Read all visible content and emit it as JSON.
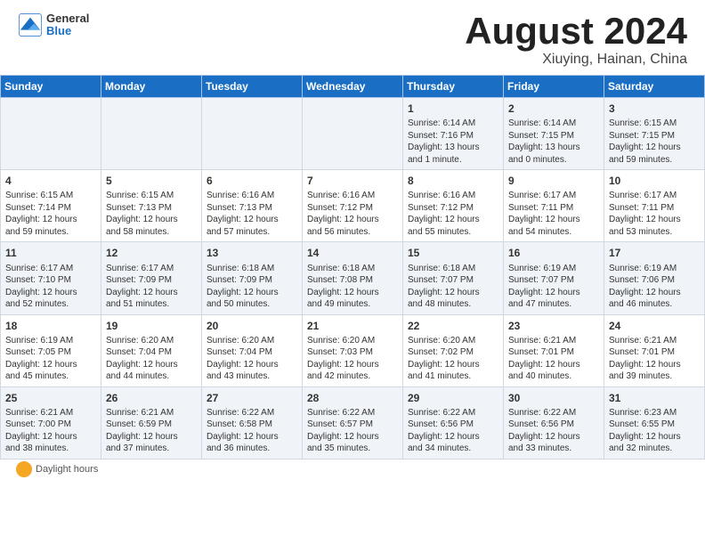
{
  "header": {
    "logo_general": "General",
    "logo_blue": "Blue",
    "title": "August 2024",
    "location": "Xiuying, Hainan, China"
  },
  "days_of_week": [
    "Sunday",
    "Monday",
    "Tuesday",
    "Wednesday",
    "Thursday",
    "Friday",
    "Saturday"
  ],
  "weeks": [
    [
      {
        "num": "",
        "info": ""
      },
      {
        "num": "",
        "info": ""
      },
      {
        "num": "",
        "info": ""
      },
      {
        "num": "",
        "info": ""
      },
      {
        "num": "1",
        "info": "Sunrise: 6:14 AM\nSunset: 7:16 PM\nDaylight: 13 hours\nand 1 minute."
      },
      {
        "num": "2",
        "info": "Sunrise: 6:14 AM\nSunset: 7:15 PM\nDaylight: 13 hours\nand 0 minutes."
      },
      {
        "num": "3",
        "info": "Sunrise: 6:15 AM\nSunset: 7:15 PM\nDaylight: 12 hours\nand 59 minutes."
      }
    ],
    [
      {
        "num": "4",
        "info": "Sunrise: 6:15 AM\nSunset: 7:14 PM\nDaylight: 12 hours\nand 59 minutes."
      },
      {
        "num": "5",
        "info": "Sunrise: 6:15 AM\nSunset: 7:13 PM\nDaylight: 12 hours\nand 58 minutes."
      },
      {
        "num": "6",
        "info": "Sunrise: 6:16 AM\nSunset: 7:13 PM\nDaylight: 12 hours\nand 57 minutes."
      },
      {
        "num": "7",
        "info": "Sunrise: 6:16 AM\nSunset: 7:12 PM\nDaylight: 12 hours\nand 56 minutes."
      },
      {
        "num": "8",
        "info": "Sunrise: 6:16 AM\nSunset: 7:12 PM\nDaylight: 12 hours\nand 55 minutes."
      },
      {
        "num": "9",
        "info": "Sunrise: 6:17 AM\nSunset: 7:11 PM\nDaylight: 12 hours\nand 54 minutes."
      },
      {
        "num": "10",
        "info": "Sunrise: 6:17 AM\nSunset: 7:11 PM\nDaylight: 12 hours\nand 53 minutes."
      }
    ],
    [
      {
        "num": "11",
        "info": "Sunrise: 6:17 AM\nSunset: 7:10 PM\nDaylight: 12 hours\nand 52 minutes."
      },
      {
        "num": "12",
        "info": "Sunrise: 6:17 AM\nSunset: 7:09 PM\nDaylight: 12 hours\nand 51 minutes."
      },
      {
        "num": "13",
        "info": "Sunrise: 6:18 AM\nSunset: 7:09 PM\nDaylight: 12 hours\nand 50 minutes."
      },
      {
        "num": "14",
        "info": "Sunrise: 6:18 AM\nSunset: 7:08 PM\nDaylight: 12 hours\nand 49 minutes."
      },
      {
        "num": "15",
        "info": "Sunrise: 6:18 AM\nSunset: 7:07 PM\nDaylight: 12 hours\nand 48 minutes."
      },
      {
        "num": "16",
        "info": "Sunrise: 6:19 AM\nSunset: 7:07 PM\nDaylight: 12 hours\nand 47 minutes."
      },
      {
        "num": "17",
        "info": "Sunrise: 6:19 AM\nSunset: 7:06 PM\nDaylight: 12 hours\nand 46 minutes."
      }
    ],
    [
      {
        "num": "18",
        "info": "Sunrise: 6:19 AM\nSunset: 7:05 PM\nDaylight: 12 hours\nand 45 minutes."
      },
      {
        "num": "19",
        "info": "Sunrise: 6:20 AM\nSunset: 7:04 PM\nDaylight: 12 hours\nand 44 minutes."
      },
      {
        "num": "20",
        "info": "Sunrise: 6:20 AM\nSunset: 7:04 PM\nDaylight: 12 hours\nand 43 minutes."
      },
      {
        "num": "21",
        "info": "Sunrise: 6:20 AM\nSunset: 7:03 PM\nDaylight: 12 hours\nand 42 minutes."
      },
      {
        "num": "22",
        "info": "Sunrise: 6:20 AM\nSunset: 7:02 PM\nDaylight: 12 hours\nand 41 minutes."
      },
      {
        "num": "23",
        "info": "Sunrise: 6:21 AM\nSunset: 7:01 PM\nDaylight: 12 hours\nand 40 minutes."
      },
      {
        "num": "24",
        "info": "Sunrise: 6:21 AM\nSunset: 7:01 PM\nDaylight: 12 hours\nand 39 minutes."
      }
    ],
    [
      {
        "num": "25",
        "info": "Sunrise: 6:21 AM\nSunset: 7:00 PM\nDaylight: 12 hours\nand 38 minutes."
      },
      {
        "num": "26",
        "info": "Sunrise: 6:21 AM\nSunset: 6:59 PM\nDaylight: 12 hours\nand 37 minutes."
      },
      {
        "num": "27",
        "info": "Sunrise: 6:22 AM\nSunset: 6:58 PM\nDaylight: 12 hours\nand 36 minutes."
      },
      {
        "num": "28",
        "info": "Sunrise: 6:22 AM\nSunset: 6:57 PM\nDaylight: 12 hours\nand 35 minutes."
      },
      {
        "num": "29",
        "info": "Sunrise: 6:22 AM\nSunset: 6:56 PM\nDaylight: 12 hours\nand 34 minutes."
      },
      {
        "num": "30",
        "info": "Sunrise: 6:22 AM\nSunset: 6:56 PM\nDaylight: 12 hours\nand 33 minutes."
      },
      {
        "num": "31",
        "info": "Sunrise: 6:23 AM\nSunset: 6:55 PM\nDaylight: 12 hours\nand 32 minutes."
      }
    ]
  ],
  "footer": {
    "daylight_label": "Daylight hours"
  }
}
